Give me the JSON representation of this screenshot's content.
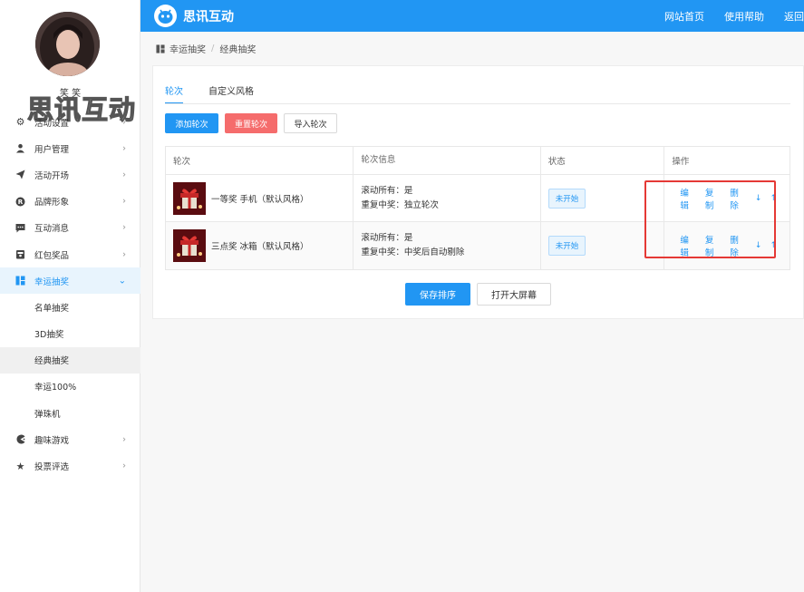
{
  "header": {
    "brand": "思讯互动",
    "nav": [
      "网站首页",
      "使用帮助",
      "返回"
    ]
  },
  "sidebar": {
    "username": "笑 笑",
    "watermark": "思讯互动",
    "items": [
      {
        "label": "活动设置",
        "icon": "gears-icon"
      },
      {
        "label": "用户管理",
        "icon": "user-icon"
      },
      {
        "label": "活动开场",
        "icon": "send-icon"
      },
      {
        "label": "品牌形象",
        "icon": "registered-icon"
      },
      {
        "label": "互动消息",
        "icon": "chat-icon"
      },
      {
        "label": "红包奖品",
        "icon": "gift-icon"
      },
      {
        "label": "幸运抽奖",
        "icon": "lottery-icon",
        "active": true
      },
      {
        "label": "趣味游戏",
        "icon": "pacman-icon"
      },
      {
        "label": "投票评选",
        "icon": "star-icon"
      }
    ],
    "submenu": [
      "名单抽奖",
      "3D抽奖",
      "经典抽奖",
      "幸运100%",
      "弹珠机"
    ]
  },
  "breadcrumb": {
    "parent": "幸运抽奖",
    "separator": "/",
    "current": "经典抽奖"
  },
  "tabs": [
    "轮次",
    "自定义风格"
  ],
  "toolbar": {
    "add": "添加轮次",
    "reset": "重置轮次",
    "import": "导入轮次"
  },
  "table": {
    "headers": [
      "轮次",
      "轮次信息",
      "状态",
      "操作"
    ],
    "rows": [
      {
        "name": "一等奖 手机（默认风格）",
        "info1": "滚动所有：是",
        "info2": "重复中奖：独立轮次",
        "status": "未开始"
      },
      {
        "name": "三点奖 冰箱（默认风格）",
        "info1": "滚动所有：是",
        "info2": "重复中奖：中奖后自动剔除",
        "status": "未开始"
      }
    ],
    "ops": {
      "edit": "编辑",
      "copy": "复制",
      "delete": "删除",
      "down": "↓",
      "up": "↑"
    }
  },
  "footer": {
    "save": "保存排序",
    "screen": "打开大屏幕"
  },
  "colors": {
    "primary": "#2196f3",
    "danger": "#f56c6c",
    "highlight": "#e53935"
  }
}
